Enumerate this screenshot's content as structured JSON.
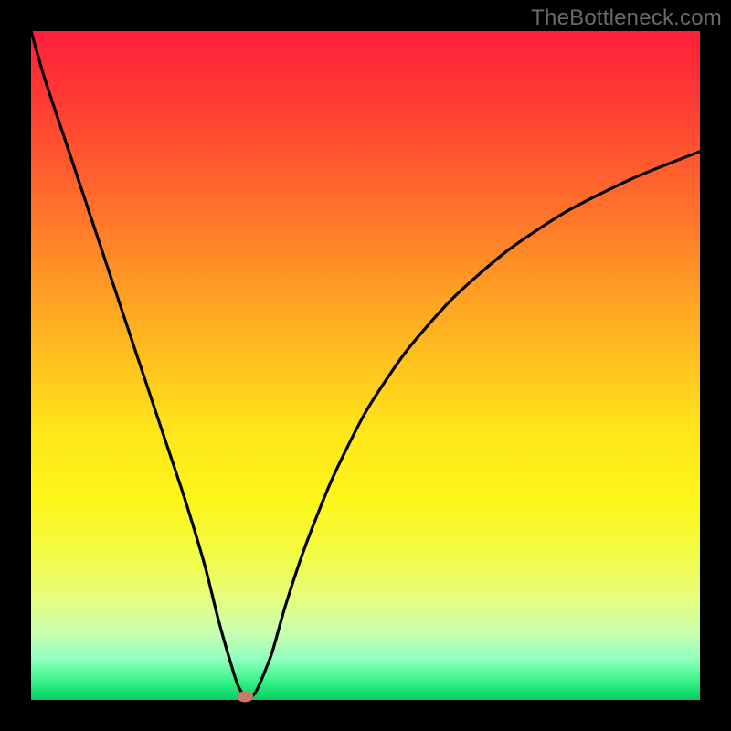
{
  "watermark": "TheBottleneck.com",
  "chart_data": {
    "type": "line",
    "title": "",
    "xlabel": "",
    "ylabel": "",
    "xlim": [
      0,
      100
    ],
    "ylim": [
      0,
      100
    ],
    "series": [
      {
        "name": "curve",
        "x": [
          0,
          2,
          5,
          8,
          11,
          14,
          17,
          20,
          23,
          26,
          28,
          30,
          31,
          32,
          33,
          34,
          36,
          38,
          41,
          45,
          50,
          56,
          63,
          71,
          80,
          90,
          100
        ],
        "y": [
          100,
          93,
          84,
          75,
          66,
          57,
          48,
          39,
          30,
          20,
          12,
          5,
          2,
          0.5,
          0.5,
          2,
          7,
          14,
          23,
          33,
          43,
          52,
          60,
          67,
          73,
          78,
          82
        ]
      }
    ],
    "marker": {
      "x": 32,
      "y": 0.5
    }
  },
  "colors": {
    "curve_stroke": "#000000",
    "marker_fill": "#c97a6a",
    "background_frame": "#000000"
  }
}
